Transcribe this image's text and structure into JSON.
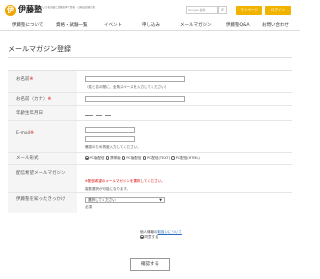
{
  "header": {
    "logo_mark": "伊",
    "logo_text": "伊藤塾",
    "tagline": "高い合格実績と受験指導で資格・公務員試験合格を",
    "search_placeholder": "Google 提供",
    "search_icon": "search-icon",
    "mypage_label": "マイページ",
    "login_label": "ログイン"
  },
  "nav": {
    "items": [
      "伊藤塾について",
      "資格・試験一覧",
      "イベント",
      "申し込み",
      "メールマガジン",
      "伊藤塾Q&A",
      "お問い合わせ"
    ]
  },
  "page": {
    "title": "メールマガジン登録"
  },
  "form": {
    "name": {
      "label": "お名前",
      "required": "※",
      "note": "（姓と名の間に、全角スペースを入力してください）"
    },
    "kana": {
      "label": "お名前（カナ）",
      "required": "※"
    },
    "age": {
      "label": "年齢生年月日"
    },
    "email": {
      "label": "E-mail",
      "required": "※",
      "note": "確認のため再度入力してください。"
    },
    "format": {
      "label": "メール形式",
      "options": [
        "PC版配信",
        "携帯版",
        "PC版配信",
        "PC配信(TEXT)",
        "PC配信(HTML)"
      ],
      "selected_index": 0
    },
    "interest": {
      "label": "配信希望メールマガジン",
      "error": "※配信希望のメールマガジンを選択してください。",
      "note": "複数選択が可能になります。"
    },
    "source": {
      "label": "伊藤塾を知ったきっかけ",
      "select_value": "選択してください",
      "caret": "▼",
      "note": "必須"
    }
  },
  "privacy": {
    "text": "個人情報の",
    "link": "取扱いについて",
    "agree_label": "同意する"
  },
  "submit": {
    "label": "確認する"
  },
  "colors": {
    "accent": "#f0b400",
    "error": "#dd0000",
    "label_bg": "#f5f5f5"
  }
}
